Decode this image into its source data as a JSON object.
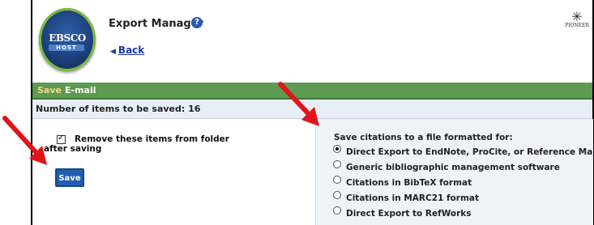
{
  "header": {
    "logo_text": "EBSCO",
    "logo_subtext": "HOST",
    "title": "Export Manager",
    "help_icon": "question-circle-icon",
    "back_label": "Back",
    "partner_logo_text": "PIONEER"
  },
  "tabs": [
    {
      "label": "Save",
      "active": true
    },
    {
      "label": "E-mail",
      "active": false
    }
  ],
  "count_label": "Number of items to be saved: 16",
  "remove_option": {
    "label": "Remove these items from folder after saving",
    "checked": true
  },
  "save_button_label": "Save",
  "export_options": {
    "heading": "Save citations to a file formatted for:",
    "items": [
      {
        "label": "Direct Export to EndNote, ProCite, or Reference Manager",
        "selected": true
      },
      {
        "label": "Generic bibliographic management software",
        "selected": false
      },
      {
        "label": "Citations in BibTeX format",
        "selected": false
      },
      {
        "label": "Citations in MARC21 format",
        "selected": false
      },
      {
        "label": "Direct Export to RefWorks",
        "selected": false
      }
    ]
  },
  "colors": {
    "tab_bar": "#5e9a52",
    "active_tab_text": "#f3d88a",
    "button": "#1f5fb3",
    "link": "#1a37a8",
    "annotation_arrow": "#e0141a"
  }
}
